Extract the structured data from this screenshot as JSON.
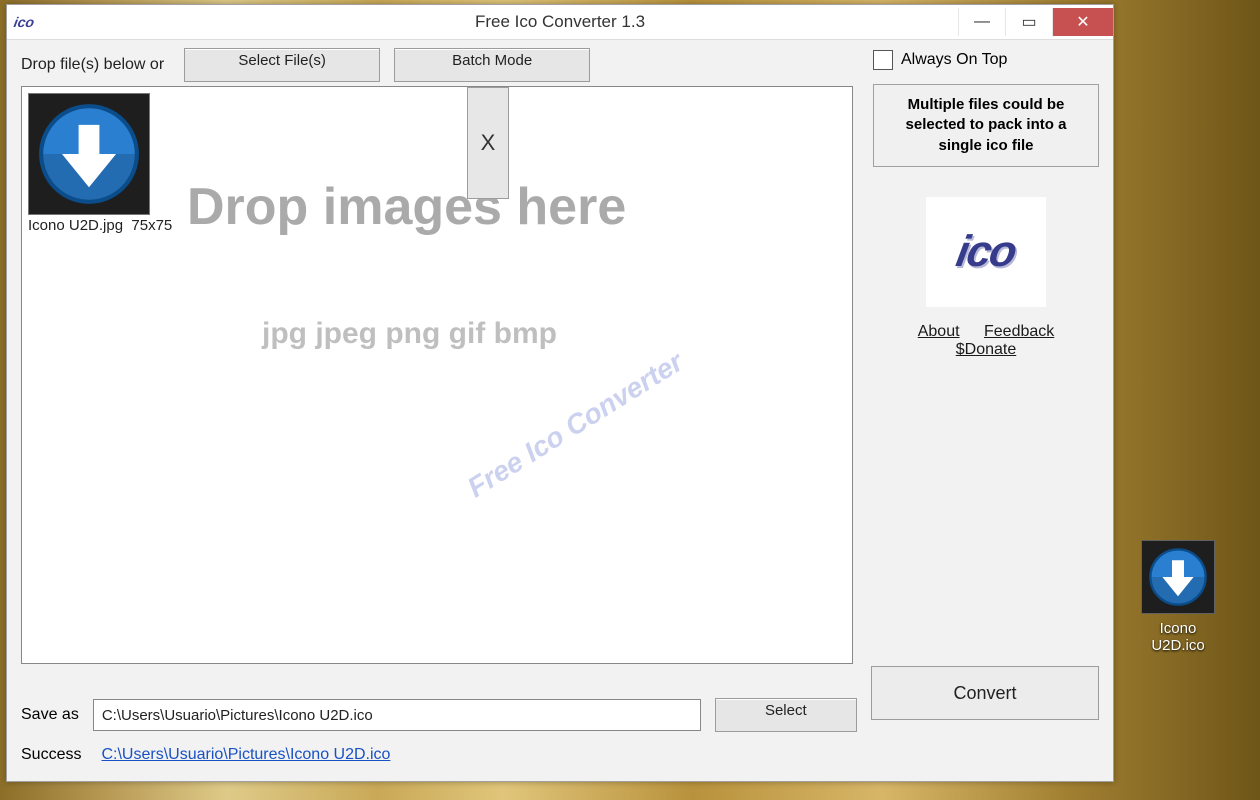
{
  "window": {
    "title": "Free Ico Converter 1.3",
    "minimize": "—",
    "maximize": "▭",
    "close": "✕"
  },
  "toolbar": {
    "drop_label": "Drop file(s) below or",
    "select_files": "Select File(s)",
    "batch_mode": "Batch Mode"
  },
  "right": {
    "always_on_top": "Always On Top",
    "tip": "Multiple files could be selected to pack into a single ico file",
    "about": "About",
    "feedback": "Feedback",
    "donate": "$Donate"
  },
  "dropzone": {
    "ghost_main": "Drop images here",
    "ghost_ext": "jpg jpeg png gif bmp",
    "watermark": "Free Ico Converter",
    "remove": "X",
    "thumb_caption_name": "Icono U2D.jpg",
    "thumb_caption_size": "75x75"
  },
  "save": {
    "label": "Save as",
    "path": "C:\\Users\\Usuario\\Pictures\\Icono U2D.ico",
    "select": "Select"
  },
  "status": {
    "label": "Success",
    "link": "C:\\Users\\Usuario\\Pictures\\Icono U2D.ico"
  },
  "convert": "Convert",
  "desktop_icon": {
    "line1": "Icono",
    "line2": "U2D.ico"
  },
  "logo_text": "ico"
}
